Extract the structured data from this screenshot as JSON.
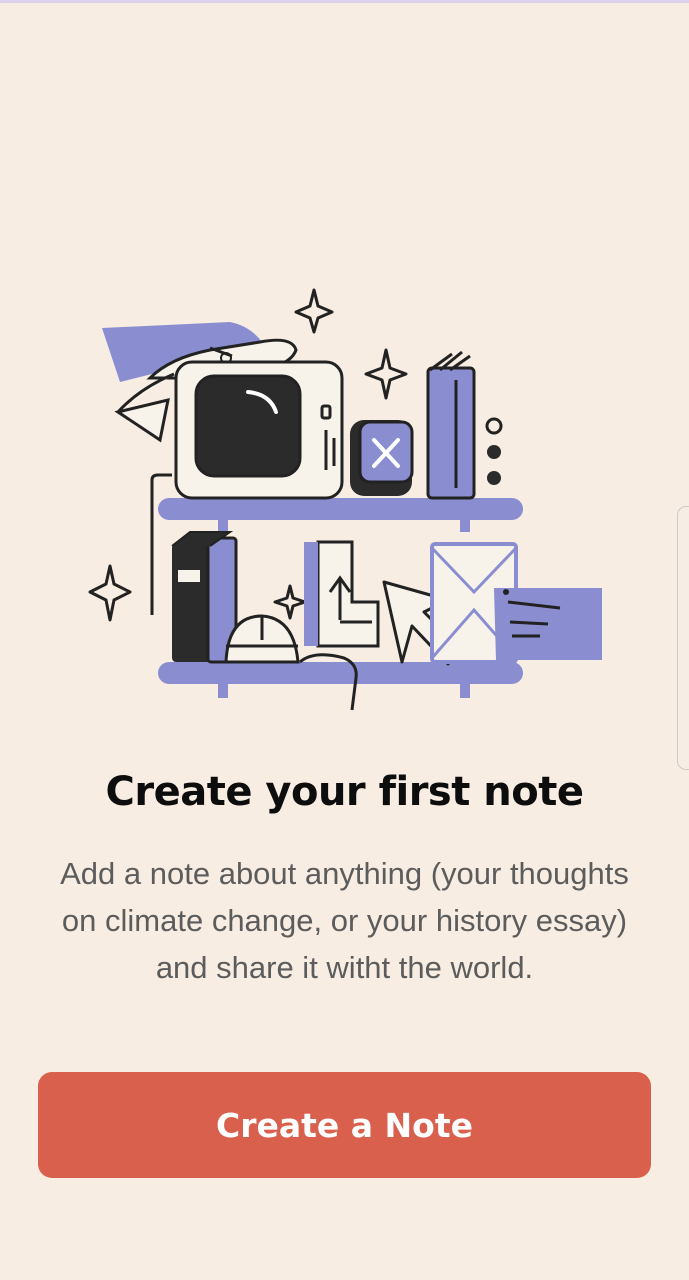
{
  "empty_state": {
    "title": "Create your first note",
    "description": "Add a note about anything (your thoughts on climate change, or your history essay) and share it witht the world.",
    "cta_label": "Create a Note",
    "illustration_icon": "shelf-with-devices-illustration"
  },
  "colors": {
    "background": "#f8ede3",
    "accent": "#d9604c",
    "illustration_purple": "#8a8ed0",
    "title_text": "#0d0d0d",
    "body_text": "#5c5c5c"
  }
}
